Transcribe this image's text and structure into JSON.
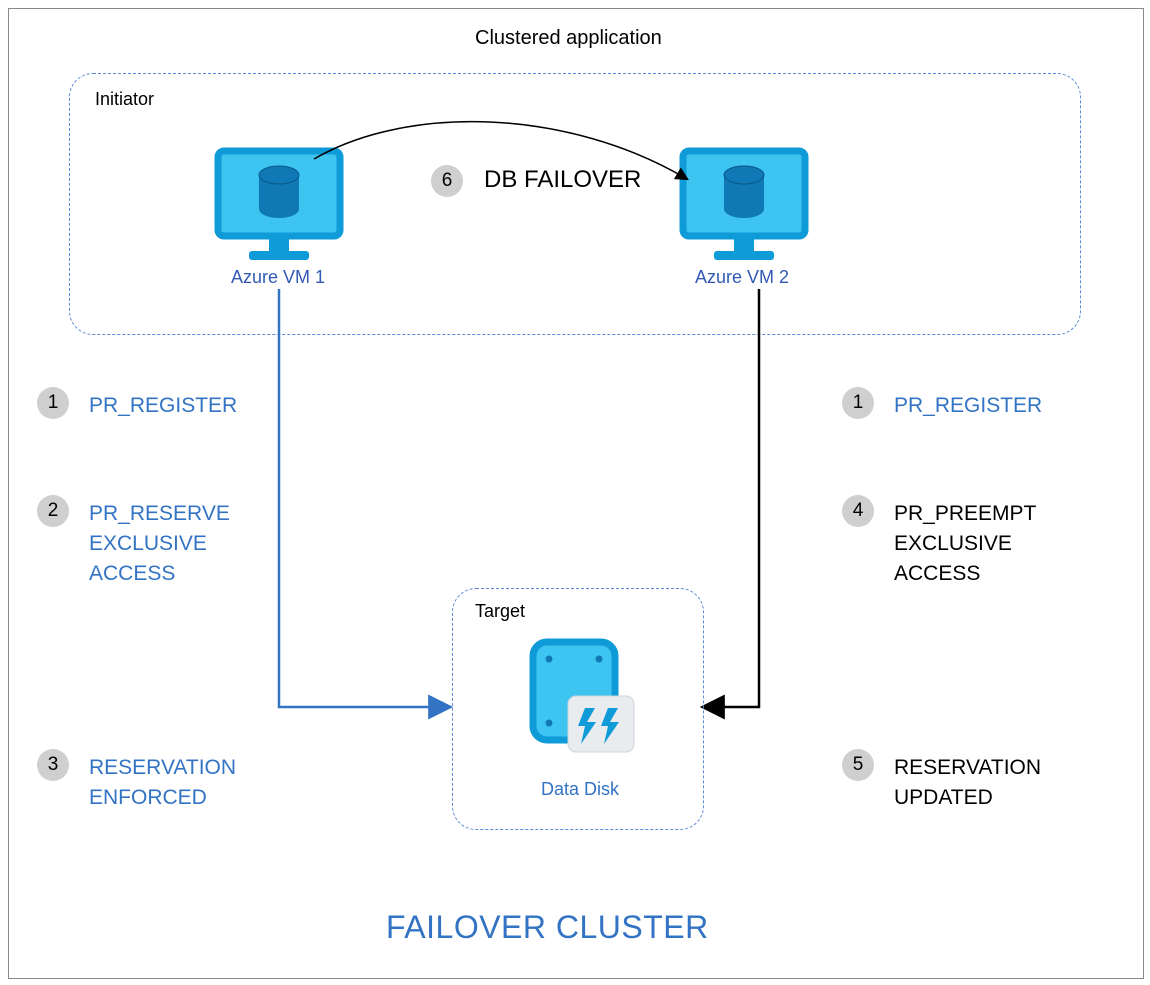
{
  "title": "Clustered application",
  "footer": "FAILOVER CLUSTER",
  "initiator_label": "Initiator",
  "target_label": "Target",
  "vm1_label": "Azure VM 1",
  "vm2_label": "Azure VM 2",
  "disk_label": "Data Disk",
  "failover": {
    "num": "6",
    "label": "DB FAILOVER"
  },
  "left_steps": [
    {
      "num": "1",
      "text": "PR_REGISTER"
    },
    {
      "num": "2",
      "text": "PR_RESERVE\nEXCLUSIVE\nACCESS"
    },
    {
      "num": "3",
      "text": "RESERVATION\nENFORCED"
    }
  ],
  "right_steps": [
    {
      "num": "1",
      "text": "PR_REGISTER"
    },
    {
      "num": "4",
      "text": "PR_PREEMPT\nEXCLUSIVE\nACCESS"
    },
    {
      "num": "5",
      "text": "RESERVATION\nUPDATED"
    }
  ],
  "colors": {
    "azure_blue": "#0f9ad8",
    "azure_fill": "#3dc4f0",
    "text_blue": "#3273c3",
    "dash_blue": "#5a8ad6"
  }
}
